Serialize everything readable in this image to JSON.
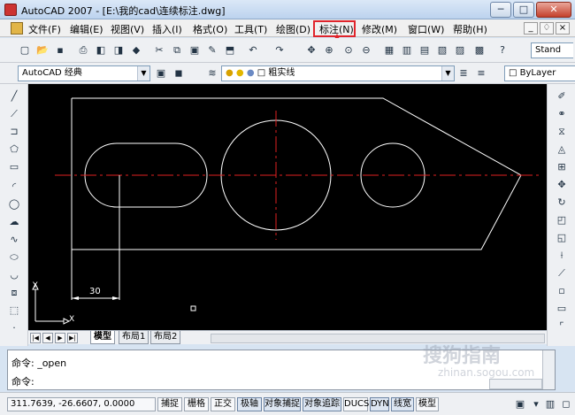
{
  "window": {
    "title": "AutoCAD 2007 - [E:\\我的cad\\连续标注.dwg]",
    "minimize_glyph": "─",
    "maximize_glyph": "□",
    "close_glyph": "✕"
  },
  "menu": {
    "items": [
      "文件(F)",
      "编辑(E)",
      "视图(V)",
      "插入(I)",
      "格式(O)",
      "工具(T)",
      "绘图(D)",
      "标注(N)",
      "修改(M)",
      "窗口(W)",
      "帮助(H)"
    ],
    "highlighted": "标注(N)",
    "mdi_controls": [
      "_",
      "♢",
      "×"
    ]
  },
  "toolbar_standard": {
    "style_combo": "Stand"
  },
  "toolbar_workspace": {
    "workspace_combo": "AutoCAD 经典",
    "layer_combo": "粗实线",
    "color_combo": "ByLayer"
  },
  "drawing": {
    "dimension_value": "30",
    "ucs_x": "X",
    "ucs_y": "Y",
    "colors": {
      "background": "#000000",
      "outline": "#ffffff",
      "centerline": "#e02020"
    }
  },
  "layout_tabs": {
    "tabs": [
      "模型",
      "布局1",
      "布局2"
    ],
    "active": "模型"
  },
  "command": {
    "line1": "命令: _open",
    "line2": "命令:"
  },
  "status": {
    "coordinates": "311.7639, -26.6607, 0.0000",
    "buttons": [
      "捕捉",
      "栅格",
      "正交",
      "极轴",
      "对象捕捉",
      "对象追踪",
      "DUCS",
      "DYN",
      "线宽",
      "模型"
    ]
  },
  "watermark": {
    "main": "搜狗指南",
    "sub": "zhinan.sogou.com"
  }
}
